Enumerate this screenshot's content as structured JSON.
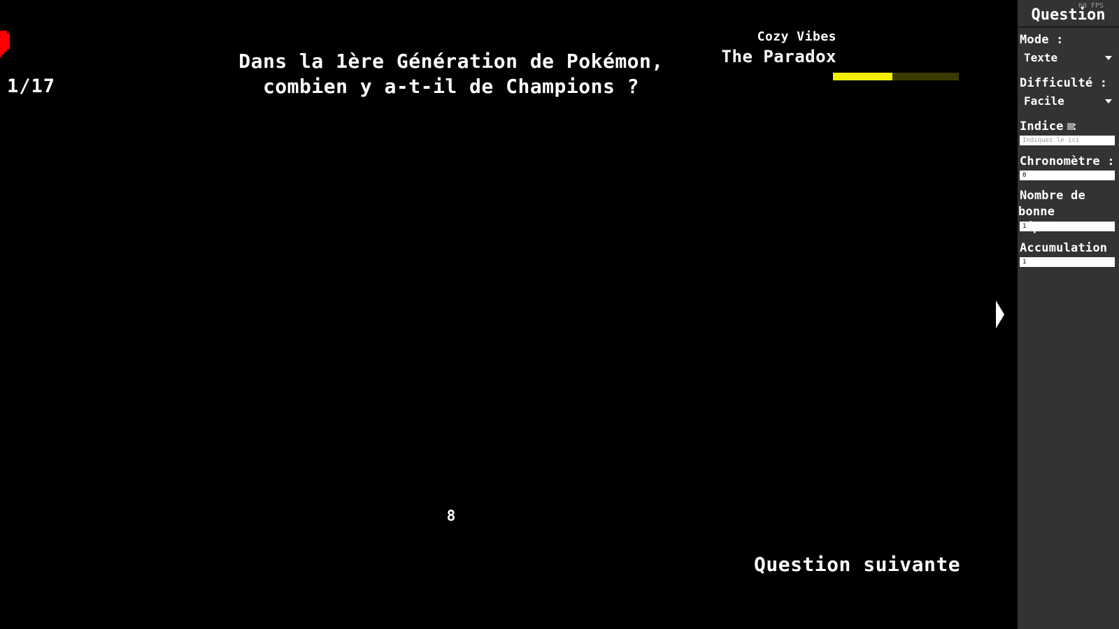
{
  "game": {
    "progress_counter": "1/17",
    "question": "Dans la 1ère Génération de Pokémon, combien y a-t-il de Champions ?",
    "answer": "8",
    "next_button": "Question suivante",
    "music": {
      "artist": "Cozy Vibes",
      "title": "The Paradox",
      "progress": 0.47,
      "fill_color": "#f4ee00",
      "track_color": "#3a3a00"
    },
    "heart_color": "#ff0000"
  },
  "panel": {
    "fps": "60 FPS",
    "title": "Question",
    "mode_label": "Mode :",
    "mode_value": "Texte",
    "difficulty_label": "Difficulté :",
    "difficulty_value": "Facile",
    "hint_label": "Indice :",
    "hint_placeholder": "Indiquez le ici",
    "timer_label": "Chronomètre :",
    "timer_value": "0",
    "correct_answers_label_line1": "Nombre de",
    "correct_answers_label_line2": "bonne réponses:",
    "correct_answers_value": "1",
    "accumulation_label": "Accumulation :",
    "accumulation_value": "1"
  }
}
